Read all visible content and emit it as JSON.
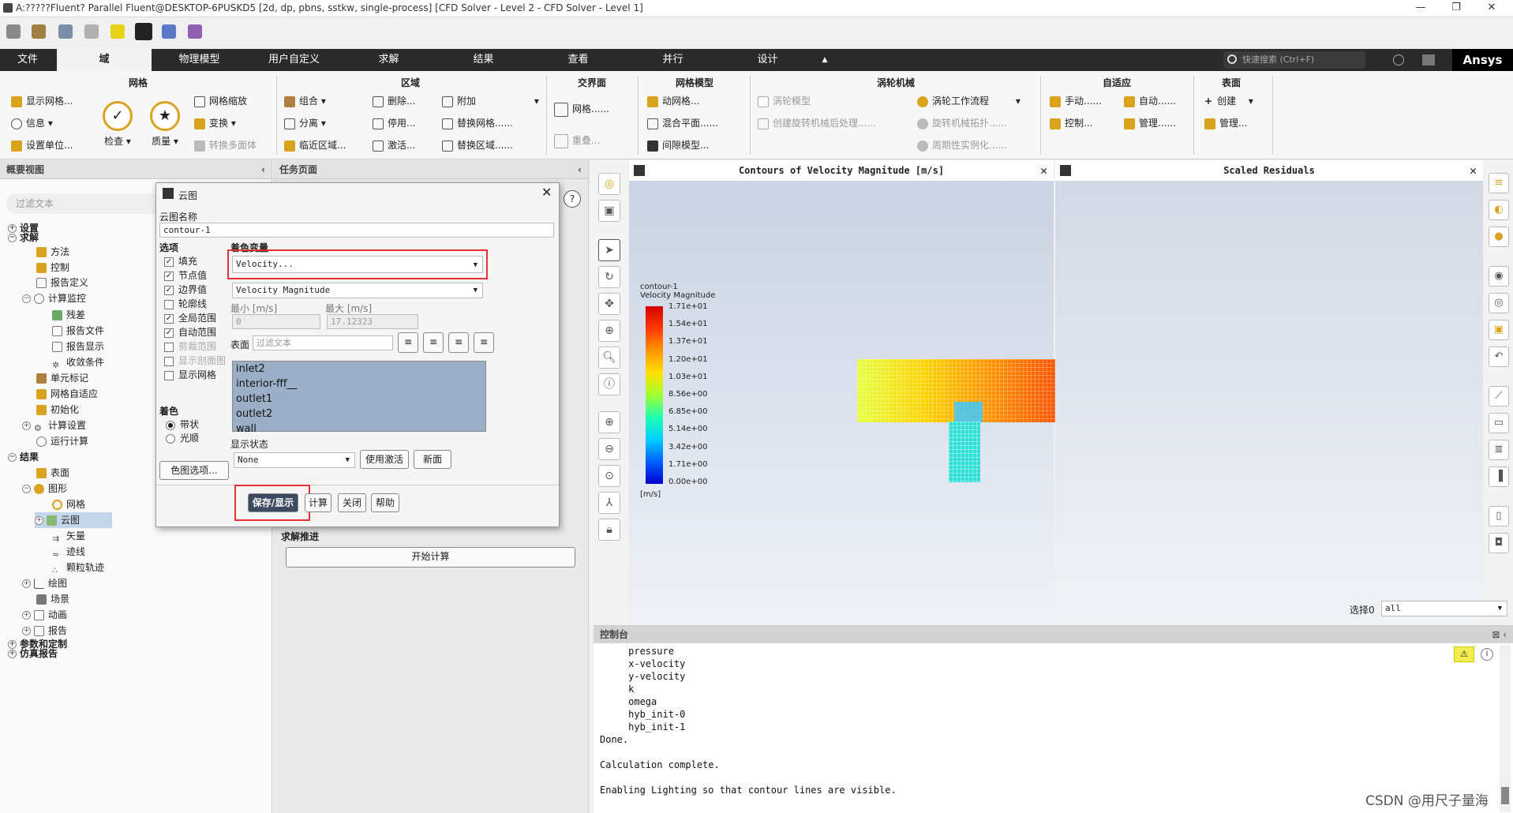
{
  "title": "A:?????Fluent? Parallel Fluent@DESKTOP-6PUSKD5  [2d, dp, pbns, sstkw, single-process] [CFD Solver - Level 2 - CFD Solver - Level 1]",
  "window_controls": [
    "—",
    "❐",
    "✕"
  ],
  "menus": [
    "文件",
    "域",
    "物理模型",
    "用户自定义",
    "求解",
    "结果",
    "查看",
    "并行",
    "设计"
  ],
  "menu_collapse": "▲",
  "search_placeholder": "快速搜索 (Ctrl+F)",
  "brand": "Ansys",
  "ribbon": {
    "mesh": {
      "title": "网格",
      "display": "显示网格...",
      "info": "信息",
      "units": "设置单位...",
      "check": "检查",
      "quality": "质量",
      "scale": "网格缩放",
      "transform": "变换",
      "convert": "转换多面体"
    },
    "zone": {
      "title": "区域",
      "combine": "组合",
      "separate": "分离",
      "adjacency": "临近区域...",
      "delete": "删除...",
      "deactivate": "停用...",
      "activate": "激活...",
      "append": "附加",
      "replace_mesh": "替换网格......",
      "replace_zone": "替换区域......"
    },
    "interface": {
      "title": "交界面",
      "mesh": "网格......",
      "overset": "重叠..."
    },
    "mesh_models": {
      "title": "网格模型",
      "dynamic": "动网格...",
      "mixing": "混合平面......",
      "gap": "间隙模型..."
    },
    "turbo": {
      "title": "涡轮机械",
      "model": "涡轮模型",
      "create_post": "创建旋转机械后处理......",
      "workflow": "涡轮工作流程",
      "topology": "旋转机械拓扑......",
      "periodic": "周期性实例化......"
    },
    "adapt": {
      "title": "自适应",
      "manual": "手动......",
      "auto": "自动......",
      "control": "控制...",
      "manage": "管理......"
    },
    "surface": {
      "title": "表面",
      "create": "创建",
      "manage": "管理..."
    }
  },
  "outline": {
    "header": "概要视图",
    "filter": "过滤文本",
    "items": [
      "设置",
      "求解",
      "方法",
      "控制",
      "报告定义",
      "计算监控",
      "残差",
      "报告文件",
      "报告显示",
      "收敛条件",
      "单元标记",
      "网格自适应",
      "初始化",
      "计算设置",
      "运行计算",
      "结果",
      "表面",
      "图形",
      "网格",
      "云图",
      "矢量",
      "迹线",
      "颗粒轨迹",
      "绘图",
      "场景",
      "动画",
      "报告",
      "参数和定制",
      "仿真报告"
    ]
  },
  "taskpage": {
    "header": "任务页面",
    "section": "求解推进",
    "run_button": "开始计算"
  },
  "dialog": {
    "title": "云图",
    "name_label": "云图名称",
    "name_value": "contour-1",
    "options_label": "选项",
    "options": [
      {
        "label": "填充",
        "checked": true,
        "enabled": true
      },
      {
        "label": "节点值",
        "checked": true,
        "enabled": true
      },
      {
        "label": "边界值",
        "checked": true,
        "enabled": true
      },
      {
        "label": "轮廓线",
        "checked": false,
        "enabled": true
      },
      {
        "label": "全局范围",
        "checked": true,
        "enabled": true
      },
      {
        "label": "自动范围",
        "checked": true,
        "enabled": true
      },
      {
        "label": "剪裁范围",
        "checked": false,
        "enabled": false
      },
      {
        "label": "显示剖面图",
        "checked": false,
        "enabled": false
      },
      {
        "label": "显示网格",
        "checked": false,
        "enabled": true
      }
    ],
    "coloring_label": "着色",
    "coloring_options": [
      "带状",
      "光顺"
    ],
    "colormap_button": "色图选项...",
    "variable_label": "着色变量",
    "variable_value": "Velocity...",
    "sub_variable": "Velocity Magnitude",
    "min_label": "最小 [m/s]",
    "max_label": "最大 [m/s]",
    "min_value": "0",
    "max_value": "17.12323",
    "surfaces_label": "表面",
    "surfaces_filter": "过滤文本",
    "surfaces": [
      "inlet2",
      "interior-fff__",
      "outlet1",
      "outlet2",
      "wall"
    ],
    "display_state_label": "显示状态",
    "display_state_value": "None",
    "use_active": "使用激活",
    "new": "新面",
    "buttons": {
      "save": "保存/显示",
      "compute": "计算",
      "close": "关闭",
      "help": "帮助"
    }
  },
  "graphics": {
    "tab1": "Contours of Velocity Magnitude [m/s]",
    "tab2": "Scaled Residuals",
    "legend_title1": "contour-1",
    "legend_title2": "Velocity Magnitude",
    "legend_values": [
      "1.71e+01",
      "1.54e+01",
      "1.37e+01",
      "1.20e+01",
      "1.03e+01",
      "8.56e+00",
      "6.85e+00",
      "5.14e+00",
      "3.42e+00",
      "1.71e+00",
      "0.00e+00"
    ],
    "legend_unit": "[m/s]",
    "select_label": "选择0",
    "select_value": "all"
  },
  "console": {
    "header": "控制台",
    "lines": [
      "     pressure",
      "     x-velocity",
      "     y-velocity",
      "     k",
      "     omega",
      "     hyb_init-0",
      "     hyb_init-1",
      "Done.",
      "",
      "Calculation complete.",
      "",
      "Enabling Lighting so that contour lines are visible."
    ]
  },
  "watermark": "CSDN @用尺子量海",
  "colors": {
    "accent_red": "#e53333",
    "dark_bar": "#2a2a2a",
    "selection": "#9bb0c6"
  }
}
